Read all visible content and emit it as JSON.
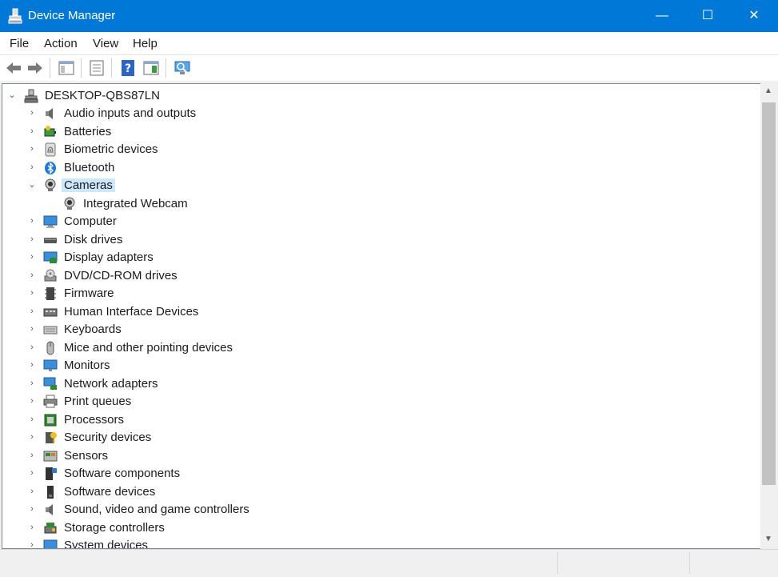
{
  "window": {
    "title": "Device Manager",
    "minimize_glyph": "—",
    "maximize_glyph": "☐",
    "close_glyph": "✕"
  },
  "menu": [
    "File",
    "Action",
    "View",
    "Help"
  ],
  "toolbar": {
    "buttons": [
      "back-arrow-icon",
      "forward-arrow-icon",
      "show-hide-console-tree-icon",
      "properties-icon",
      "help-icon",
      "action-pane-icon",
      "scan-hardware-changes-icon"
    ]
  },
  "tree": {
    "root": "DESKTOP-QBS87LN",
    "categories": [
      {
        "label": "Audio inputs and outputs",
        "icon": "speaker-icon"
      },
      {
        "label": "Batteries",
        "icon": "battery-icon"
      },
      {
        "label": "Biometric devices",
        "icon": "fingerprint-icon"
      },
      {
        "label": "Bluetooth",
        "icon": "bluetooth-icon"
      },
      {
        "label": "Cameras",
        "icon": "webcam-icon",
        "expanded": true,
        "selected": true,
        "children": [
          {
            "label": "Integrated Webcam",
            "icon": "webcam-icon"
          }
        ]
      },
      {
        "label": "Computer",
        "icon": "computer-icon"
      },
      {
        "label": "Disk drives",
        "icon": "disk-drive-icon"
      },
      {
        "label": "Display adapters",
        "icon": "display-adapter-icon"
      },
      {
        "label": "DVD/CD-ROM drives",
        "icon": "dvd-drive-icon"
      },
      {
        "label": "Firmware",
        "icon": "firmware-icon"
      },
      {
        "label": "Human Interface Devices",
        "icon": "hid-icon"
      },
      {
        "label": "Keyboards",
        "icon": "keyboard-icon"
      },
      {
        "label": "Mice and other pointing devices",
        "icon": "mouse-icon"
      },
      {
        "label": "Monitors",
        "icon": "monitor-icon"
      },
      {
        "label": "Network adapters",
        "icon": "network-adapter-icon"
      },
      {
        "label": "Print queues",
        "icon": "printer-icon"
      },
      {
        "label": "Processors",
        "icon": "processor-icon"
      },
      {
        "label": "Security devices",
        "icon": "security-device-icon"
      },
      {
        "label": "Sensors",
        "icon": "sensor-icon"
      },
      {
        "label": "Software components",
        "icon": "software-component-icon"
      },
      {
        "label": "Software devices",
        "icon": "software-device-icon"
      },
      {
        "label": "Sound, video and game controllers",
        "icon": "sound-controller-icon"
      },
      {
        "label": "Storage controllers",
        "icon": "storage-controller-icon"
      },
      {
        "label": "System devices",
        "icon": "system-device-icon"
      }
    ]
  },
  "colors": {
    "titlebar": "#0078d7",
    "selection": "#cce8ff"
  }
}
